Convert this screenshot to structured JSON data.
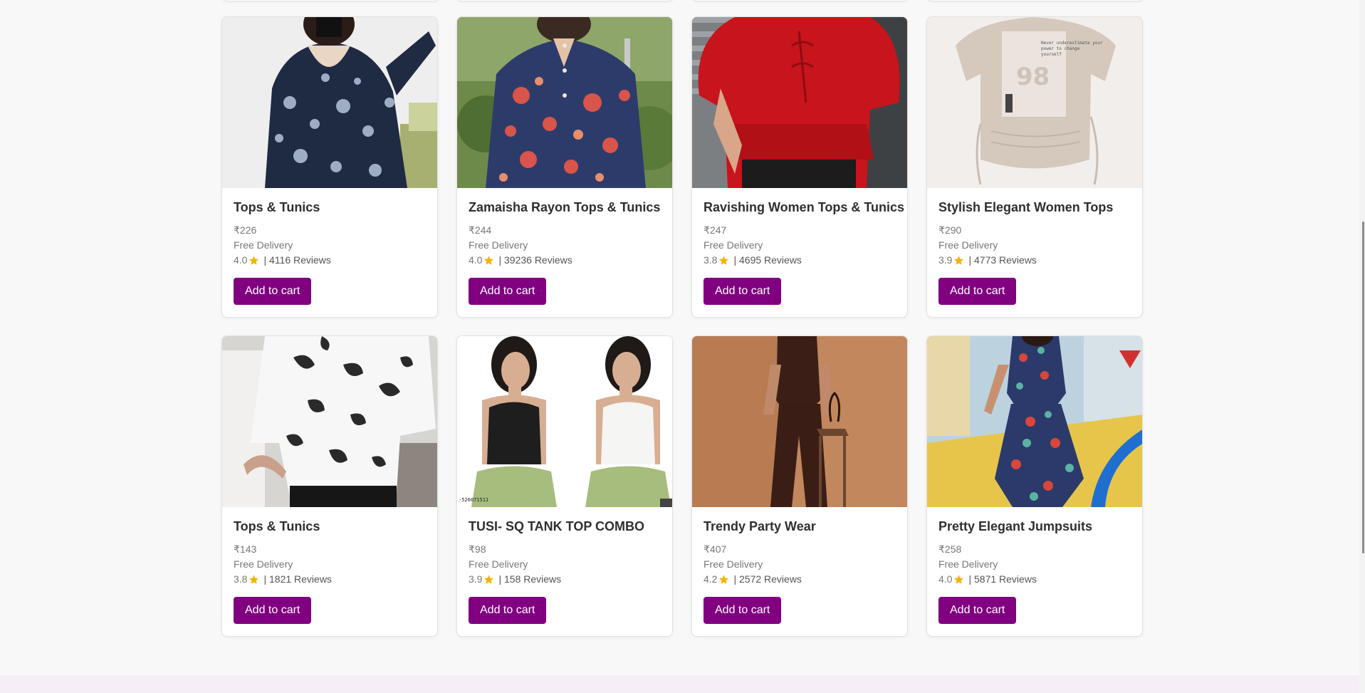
{
  "products": [
    {
      "title": "Tops & Tunics",
      "price": "₹226",
      "delivery": "Free Delivery",
      "rating": "4.0",
      "reviews": "| 4116 Reviews",
      "button": "Add to cart",
      "image_icon": "floral-tunic-photo"
    },
    {
      "title": "Zamaisha Rayon Tops & Tunics",
      "price": "₹244",
      "delivery": "Free Delivery",
      "rating": "4.0",
      "reviews": "| 39236 Reviews",
      "button": "Add to cart",
      "image_icon": "printed-rayon-top-photo"
    },
    {
      "title": "Ravishing Women Tops & Tunics",
      "price": "₹247",
      "delivery": "Free Delivery",
      "rating": "3.8",
      "reviews": "| 4695 Reviews",
      "button": "Add to cart",
      "image_icon": "red-peplum-top-photo"
    },
    {
      "title": "Stylish Elegant Women Tops",
      "price": "₹290",
      "delivery": "Free Delivery",
      "rating": "3.9",
      "reviews": "| 4773 Reviews",
      "button": "Add to cart",
      "image_icon": "beige-graphic-top-photo"
    },
    {
      "title": "Tops & Tunics",
      "price": "₹143",
      "delivery": "Free Delivery",
      "rating": "3.8",
      "reviews": "| 1821 Reviews",
      "button": "Add to cart",
      "image_icon": "tie-dye-top-photo"
    },
    {
      "title": "TUSI- SQ TANK TOP COMBO",
      "price": "₹98",
      "delivery": "Free Delivery",
      "rating": "3.9",
      "reviews": "| 158 Reviews",
      "button": "Add to cart",
      "image_icon": "tank-top-combo-photo"
    },
    {
      "title": "Trendy Party Wear",
      "price": "₹407",
      "delivery": "Free Delivery",
      "rating": "4.2",
      "reviews": "| 2572 Reviews",
      "button": "Add to cart",
      "image_icon": "brown-party-wear-photo"
    },
    {
      "title": "Pretty Elegant Jumpsuits",
      "price": "₹258",
      "delivery": "Free Delivery",
      "rating": "4.0",
      "reviews": "| 5871 Reviews",
      "button": "Add to cart",
      "image_icon": "printed-jumpsuit-photo"
    }
  ],
  "image_overlay_text": {
    "tank_combo_id": "-526071511",
    "beige_top_print": "Never underestimate your power to change yourself"
  },
  "colors": {
    "accent": "#800080",
    "star": "#f5b301",
    "footer_band": "#f6eef6",
    "page_bg": "#f8f8f8"
  }
}
